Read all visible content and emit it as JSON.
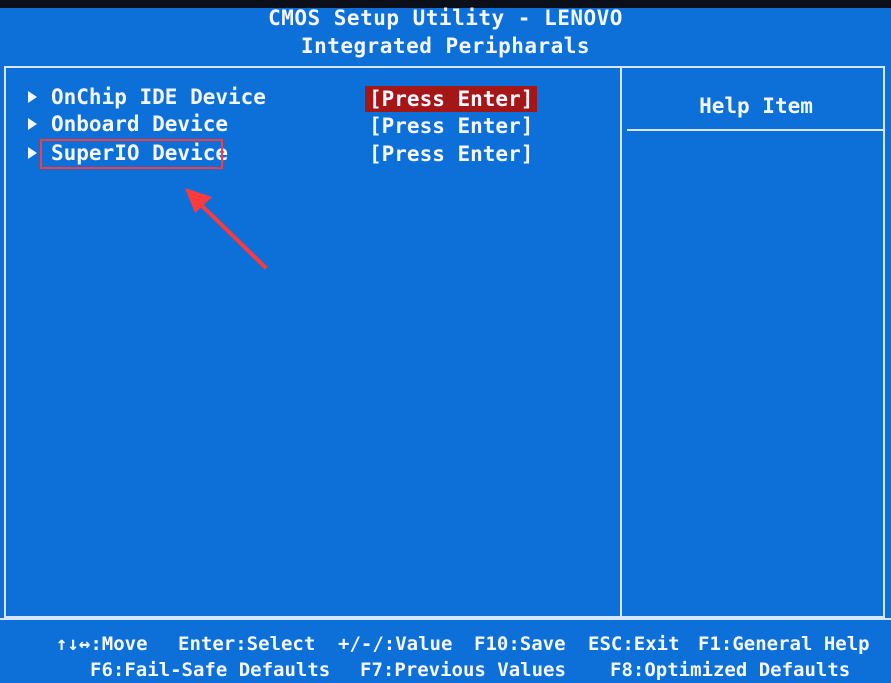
{
  "app": {
    "title": "CMOS Setup Utility - LENOVO",
    "subtitle": "Integrated Peripharals"
  },
  "menu": {
    "items": [
      {
        "label": "OnChip IDE Device",
        "value": "[Press Enter]",
        "selected": true
      },
      {
        "label": "Onboard Device",
        "value": "[Press Enter]",
        "selected": false
      },
      {
        "label": "SuperIO Device",
        "value": "[Press Enter]",
        "selected": false,
        "annotated": true
      }
    ]
  },
  "help": {
    "title": "Help Item"
  },
  "footer": {
    "row1": [
      "↑↓↔:Move",
      "Enter:Select",
      "+/-/:Value",
      "F10:Save",
      "ESC:Exit",
      "F1:General Help"
    ],
    "row2": [
      "F6:Fail-Safe Defaults",
      "F7:Previous Values",
      "F8:Optimized Defaults"
    ]
  },
  "colors": {
    "background": "#0d6fd8",
    "selected_value": "#a51616",
    "annotation": "#ff3a3a"
  }
}
